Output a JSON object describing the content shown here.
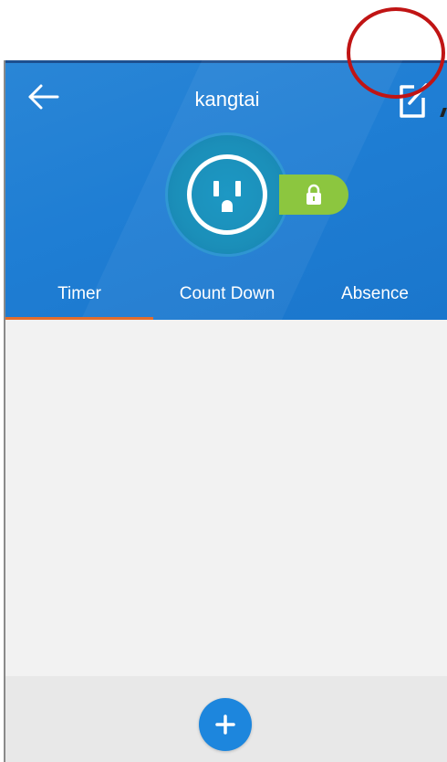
{
  "header": {
    "title": "kangtai",
    "back_icon": "arrow-left-icon",
    "edit_icon": "edit-icon"
  },
  "device": {
    "icon": "power-outlet-icon",
    "lock_icon": "lock-icon"
  },
  "tabs": [
    {
      "label": "Timer",
      "active": true
    },
    {
      "label": "Count Down",
      "active": false
    },
    {
      "label": "Absence",
      "active": false
    }
  ],
  "actions": {
    "add_icon": "plus-icon"
  },
  "colors": {
    "header_blue": "#1f7ed4",
    "tab_indicator": "#e46d2c",
    "lock_green": "#8cc63f",
    "add_button": "#1d86dd",
    "annotation_red": "#c01414"
  }
}
